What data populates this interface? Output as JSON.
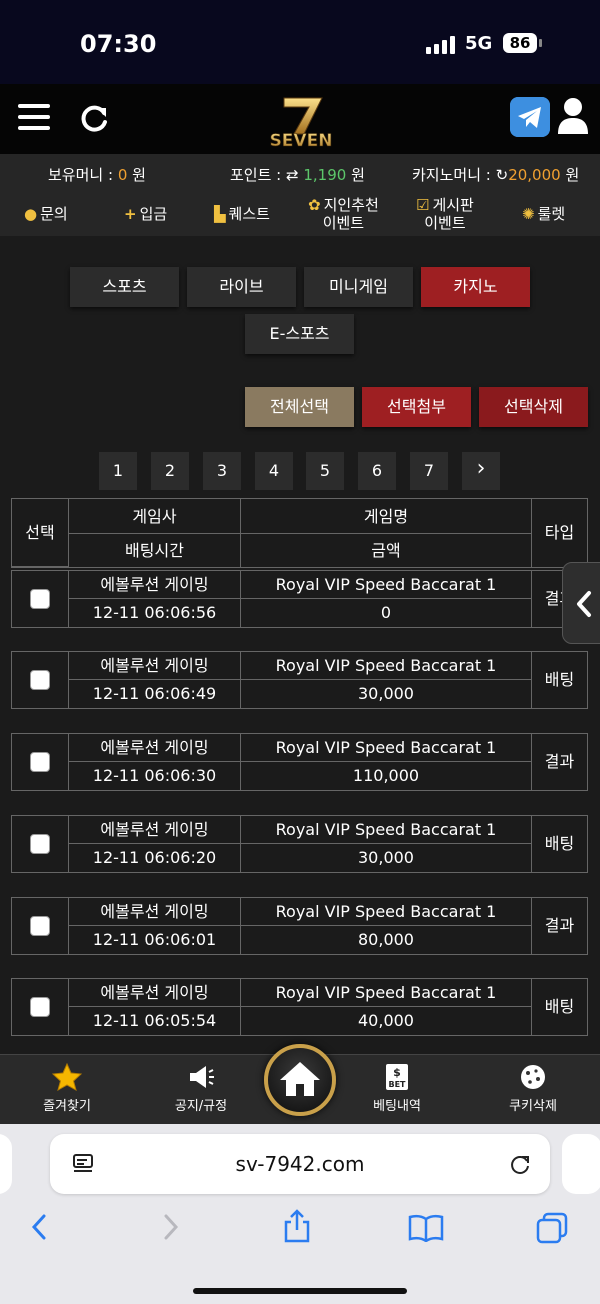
{
  "status": {
    "time": "07:30",
    "network": "5G",
    "battery": "86"
  },
  "header": {
    "logo_text": "SEVEN"
  },
  "wallet": {
    "hold_label": "보유머니 :",
    "hold_value": "0",
    "hold_unit": "원",
    "point_label": "포인트 :",
    "point_value": "1,190",
    "point_unit": "원",
    "casino_label": "카지노머니 :",
    "casino_value": "20,000",
    "casino_unit": "원"
  },
  "menu": [
    {
      "label": "문의",
      "icon": "alert-icon"
    },
    {
      "label": "입금",
      "icon": "plus-icon"
    },
    {
      "label": "퀘스트",
      "icon": "scroll-icon"
    },
    {
      "label": "지인추천",
      "label2": "이벤트",
      "icon": "paw-icon"
    },
    {
      "label": "게시판",
      "label2": "이벤트",
      "icon": "checkbox-icon"
    },
    {
      "label": "룰렛",
      "icon": "roulette-icon"
    }
  ],
  "tabs": [
    "스포츠",
    "라이브",
    "미니게임",
    "카지노",
    "E-스포츠"
  ],
  "active_tab": "카지노",
  "actions": {
    "select_all": "전체선택",
    "attach": "선택첨부",
    "delete": "선택삭제"
  },
  "pages": [
    "1",
    "2",
    "3",
    "4",
    "5",
    "6",
    "7",
    "›"
  ],
  "table": {
    "headers": {
      "select": "선택",
      "provider": "게임사",
      "game": "게임명",
      "type": "타입",
      "time": "배팅시간",
      "amount": "금액"
    },
    "rows": [
      {
        "provider": "에볼루션 게이밍",
        "game": "Royal VIP Speed Baccarat 1",
        "time": "12-11 06:06:56",
        "amount": "0",
        "type": "결과",
        "color": "green"
      },
      {
        "provider": "에볼루션 게이밍",
        "game": "Royal VIP Speed Baccarat 1",
        "time": "12-11 06:06:49",
        "amount": "30,000",
        "type": "배팅",
        "color": "orange"
      },
      {
        "provider": "에볼루션 게이밍",
        "game": "Royal VIP Speed Baccarat 1",
        "time": "12-11 06:06:30",
        "amount": "110,000",
        "type": "결과",
        "color": "green"
      },
      {
        "provider": "에볼루션 게이밍",
        "game": "Royal VIP Speed Baccarat 1",
        "time": "12-11 06:06:20",
        "amount": "30,000",
        "type": "배팅",
        "color": "orange"
      },
      {
        "provider": "에볼루션 게이밍",
        "game": "Royal VIP Speed Baccarat 1",
        "time": "12-11 06:06:01",
        "amount": "80,000",
        "type": "결과",
        "color": "green"
      },
      {
        "provider": "에볼루션 게이밍",
        "game": "Royal VIP Speed Baccarat 1",
        "time": "12-11 06:05:54",
        "amount": "40,000",
        "type": "배팅",
        "color": "orange"
      }
    ]
  },
  "bottom_nav": {
    "favorites": "즐겨찾기",
    "notice": "공지/규정",
    "bet_history": "베팅내역",
    "cookie_delete": "쿠키삭제",
    "bet_icon_text": "BET"
  },
  "browser": {
    "url": "sv-7942.com"
  },
  "colors": {
    "accent_red": "#9e1f22",
    "orange": "#f0a030",
    "green": "#5cc66a",
    "gold": "#c9a04a"
  }
}
